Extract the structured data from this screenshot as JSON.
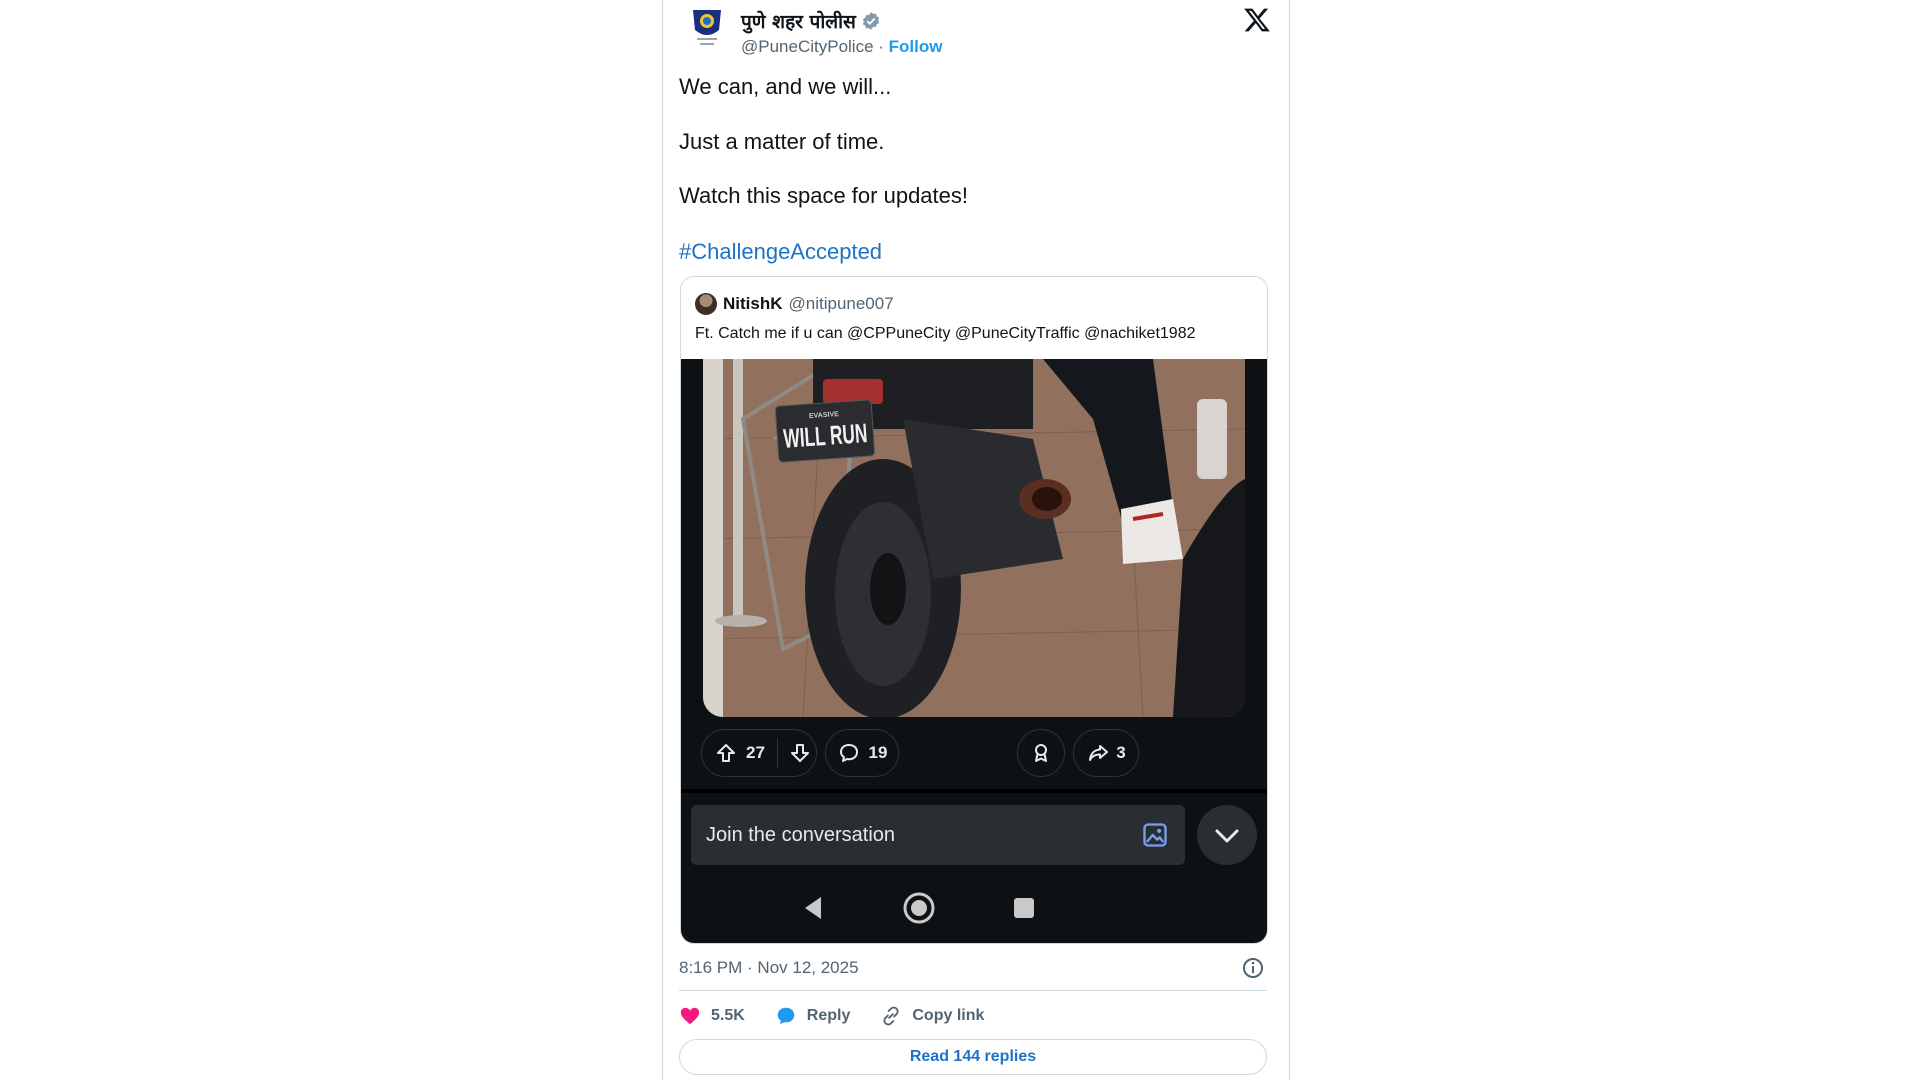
{
  "tweet": {
    "author_name": "पुणे शहर पोलीस",
    "author_handle": "@PuneCityPolice",
    "separator": " · ",
    "follow_label": "Follow",
    "lines": [
      "We can, and we will...",
      "Just a matter of time.",
      "Watch this space for updates!"
    ],
    "hashtag": "#ChallengeAccepted",
    "timestamp": "8:16 PM · Nov 12, 2025",
    "likes": "5.5K",
    "reply_label": "Reply",
    "copy_label": "Copy link",
    "read_replies_label": "Read 144 replies"
  },
  "quoted": {
    "name": "NitishK",
    "handle": "@nitipune007",
    "text": "Ft. Catch me if u can @CPPuneCity @PuneCityTraffic @nachiket1982",
    "image": {
      "plate_small": "EVASIVE",
      "plate_main": "WILL RUN"
    },
    "upvotes": "27",
    "comments": "19",
    "shares": "3",
    "join_placeholder": "Join the conversation"
  },
  "colors": {
    "link": "#1d73c7",
    "follow": "#1d9bf0",
    "like": "#f91880",
    "reply": "#1d9bf0",
    "phone_bg": "#0e1114"
  }
}
